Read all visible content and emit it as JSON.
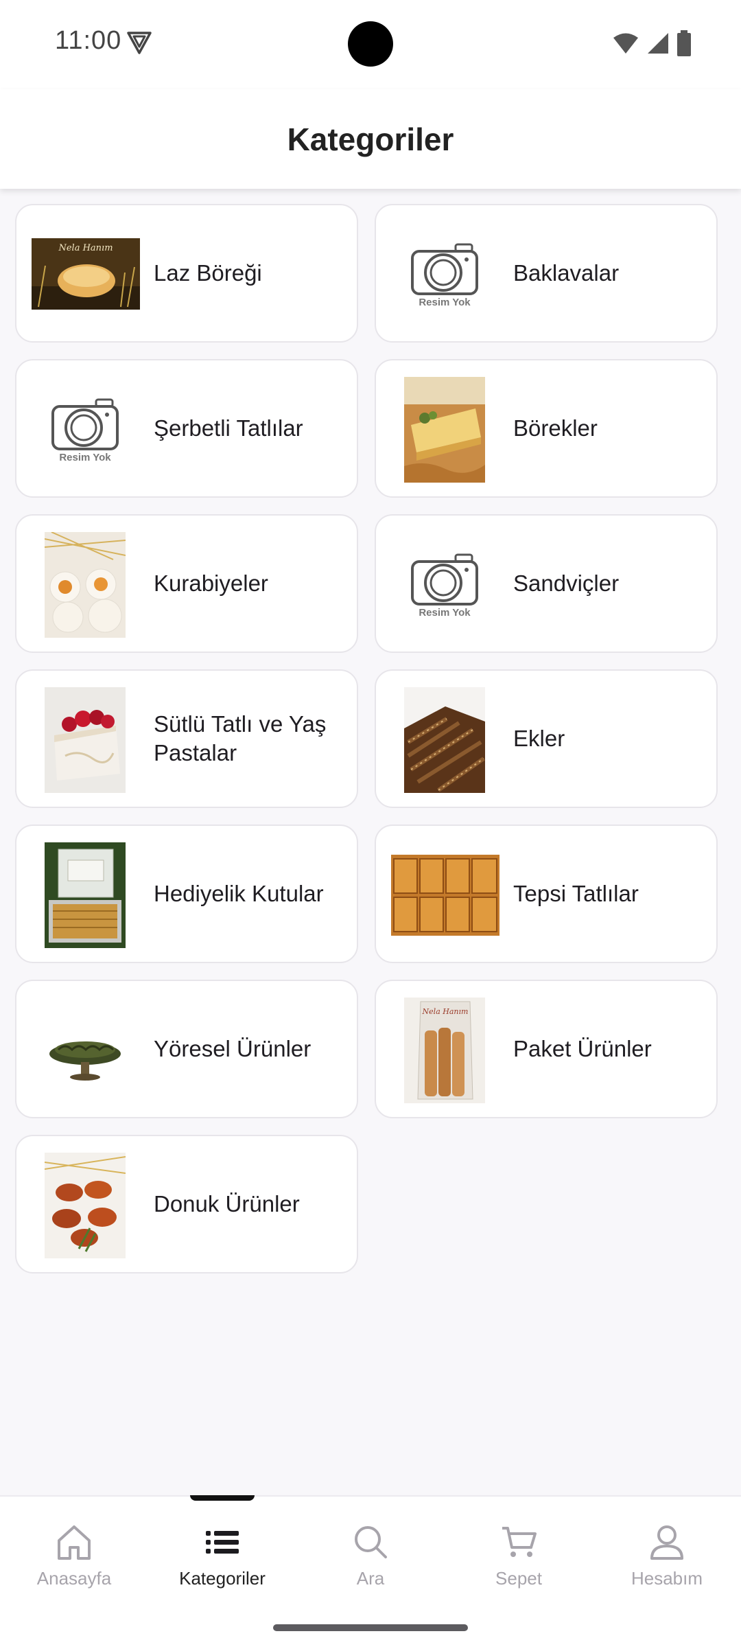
{
  "status_bar": {
    "time": "11:00"
  },
  "header": {
    "title": "Kategoriler"
  },
  "categories": [
    {
      "label": "Laz Böreği",
      "thumb": "laz-boregi-photo",
      "logo_text": "Nela Hanım"
    },
    {
      "label": "Baklavalar",
      "thumb": "no-image-placeholder",
      "placeholder_text": "Resim Yok"
    },
    {
      "label": "Şerbetli Tatlılar",
      "thumb": "no-image-placeholder",
      "placeholder_text": "Resim Yok"
    },
    {
      "label": "Börekler",
      "thumb": "borek-photo"
    },
    {
      "label": "Kurabiyeler",
      "thumb": "kurabiye-photo"
    },
    {
      "label": "Sandviçler",
      "thumb": "no-image-placeholder",
      "placeholder_text": "Resim Yok"
    },
    {
      "label": "Sütlü Tatlı ve Yaş Pastalar",
      "thumb": "pasta-photo"
    },
    {
      "label": "Ekler",
      "thumb": "ekler-photo"
    },
    {
      "label": "Hediyelik Kutular",
      "thumb": "gift-box-photo"
    },
    {
      "label": "Tepsi Tatlılar",
      "thumb": "tray-dessert-photo"
    },
    {
      "label": "Yöresel Ürünler",
      "thumb": "yoresel-photo"
    },
    {
      "label": "Paket Ürünler",
      "thumb": "packet-photo",
      "logo_text": "Nela Hanım"
    },
    {
      "label": "Donuk Ürünler",
      "thumb": "icli-kofte-photo"
    }
  ],
  "nav": [
    {
      "label": "Anasayfa",
      "icon": "home-icon",
      "active": false
    },
    {
      "label": "Kategoriler",
      "icon": "list-icon",
      "active": true
    },
    {
      "label": "Ara",
      "icon": "search-icon",
      "active": false
    },
    {
      "label": "Sepet",
      "icon": "cart-icon",
      "active": false
    },
    {
      "label": "Hesabım",
      "icon": "user-icon",
      "active": false
    }
  ],
  "colors": {
    "background": "#f8f7fa",
    "card": "#ffffff",
    "active_nav": "#222222",
    "inactive_nav": "#a7a4ab"
  }
}
